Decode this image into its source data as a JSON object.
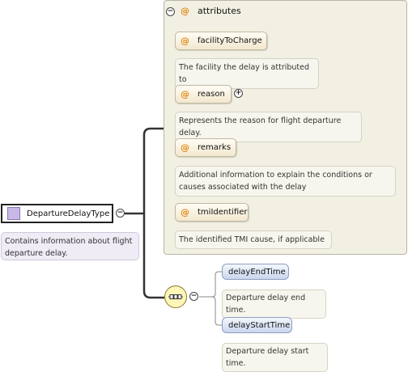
{
  "type_node": {
    "name": "DepartureDelayType",
    "documentation": "Contains information about flight departure delay."
  },
  "attributes_group": {
    "title": "attributes",
    "items": [
      {
        "name": "facilityToCharge",
        "documentation": "The facility the delay is attributed to"
      },
      {
        "name": "reason",
        "documentation": "Represents the reason for flight departure delay."
      },
      {
        "name": "remarks",
        "documentation": "Additional information to explain the conditions or causes associated with the delay"
      },
      {
        "name": "tmiIdentifier",
        "documentation": "The identified TMI cause, if applicable"
      }
    ]
  },
  "sequence": {
    "elements": [
      {
        "name": "delayEndTime",
        "documentation": "Departure delay end time."
      },
      {
        "name": "delayStartTime",
        "documentation": "Departure delay start time."
      }
    ]
  },
  "symbols": {
    "attribute_marker": "@",
    "collapse": "−",
    "expand": "+"
  },
  "colors": {
    "attribute_marker": "#e08a14",
    "type_square": "#c7b8e6",
    "sequence_icon": "#fff6b8"
  }
}
